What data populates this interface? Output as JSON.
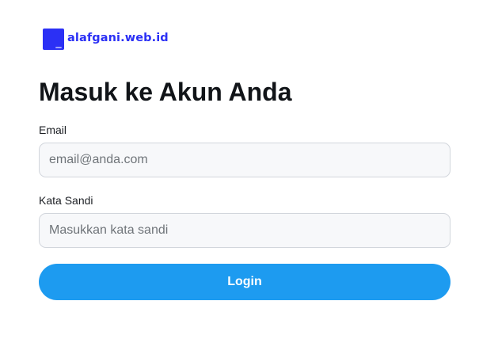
{
  "brand": {
    "name": "alafgani.web.id",
    "logo_icon": "square-logo-icon",
    "color": "#2b30f5"
  },
  "heading": "Masuk ke Akun Anda",
  "form": {
    "email": {
      "label": "Email",
      "placeholder": "email@anda.com",
      "value": ""
    },
    "password": {
      "label": "Kata Sandi",
      "placeholder": "Masukkan kata sandi",
      "value": ""
    },
    "submit_label": "Login",
    "submit_color": "#1d9bf0"
  }
}
